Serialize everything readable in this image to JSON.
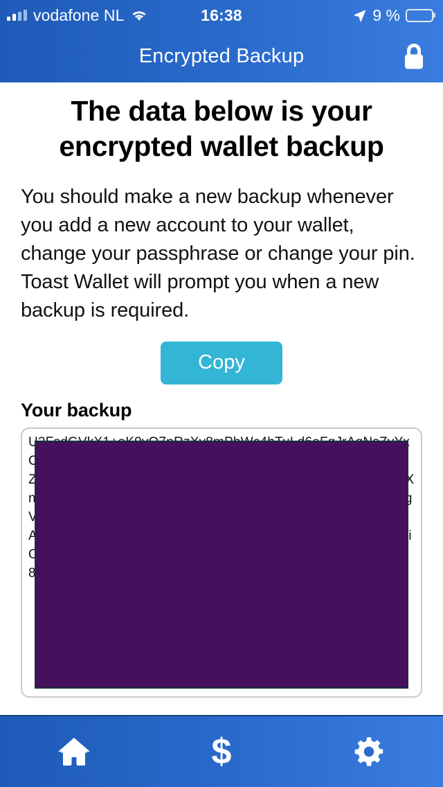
{
  "status_bar": {
    "carrier": "vodafone NL",
    "time": "16:38",
    "battery_percent": "9 %",
    "signal_icon": "signal-bars-icon",
    "wifi_icon": "wifi-icon",
    "location_icon": "location-arrow-icon",
    "battery_icon": "battery-low-icon",
    "battery_fill_color": "#f5c518"
  },
  "nav": {
    "title": "Encrypted Backup",
    "action_icon": "lock-icon",
    "background_color": "#2a6bcc"
  },
  "main": {
    "headline": "The data below is your encrypted wallet backup",
    "body": "You should make a new backup whenever you add a new account to your wallet, change your passphrase or change your pin. Toast Wallet will prompt you when a new backup is required.",
    "copy_button_label": "Copy",
    "copy_button_color": "#33b5d5",
    "section_label": "Your backup",
    "backup_value": "U2FsdGVkX1+aK9vQ7nRzXy8mPbWc4hTuLd6eFgJrAqNsZvYxCkMpEwTiObUlHnGdRyVaQoXzMfLpSeIhNcBtDwKrUgYjAvQmZxPoLnEiHsWbTdRfCaGkMvXyJqNpZlOeIuYaHrTcBgWmDkFsXnQvLpRjZoAiMeUyTbHdNcKgVwFqSlXpEoRmZaYjIuNbTdHcKgVwFqSlXpEoRmZaYjIuNbTdWxCvBnMkLjHgFdSaPoIuYtReWqAzXsCdVfBgNhMjKlPoIuYtReWqZxCvBnMkLjHgFdSaQwErTyUiOpAsDfGhJkLzXcVbNmQwErTyUiOpAsDfGhJkLzXcVbNm0192837465abcdefghijklmnopqrstuvwxyz==",
    "backup_redacted": true,
    "redaction_color": "#46115c"
  },
  "tab_bar": {
    "items": [
      {
        "name": "home",
        "icon": "home-icon"
      },
      {
        "name": "payments",
        "icon": "dollar-icon",
        "glyph": "$"
      },
      {
        "name": "settings",
        "icon": "gear-icon"
      }
    ]
  }
}
